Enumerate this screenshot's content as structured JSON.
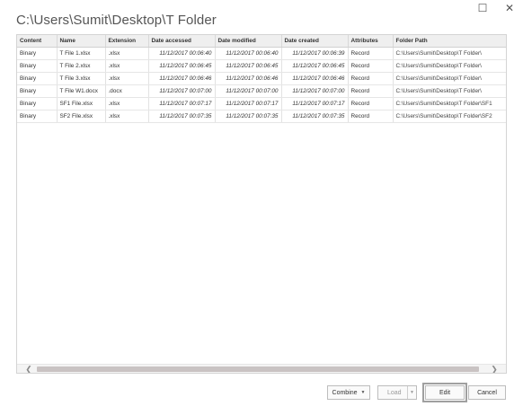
{
  "window": {
    "maximize_glyph": "☐",
    "close_glyph": "✕"
  },
  "title": "C:\\Users\\Sumit\\Desktop\\T Folder",
  "table": {
    "columns": [
      "Content",
      "Name",
      "Extension",
      "Date accessed",
      "Date modified",
      "Date created",
      "Attributes",
      "Folder Path"
    ],
    "rows": [
      [
        "Binary",
        "T File 1.xlsx",
        ".xlsx",
        "11/12/2017 00:06:40",
        "11/12/2017 00:06:40",
        "11/12/2017 00:06:39",
        "Record",
        "C:\\Users\\Sumit\\Desktop\\T Folder\\"
      ],
      [
        "Binary",
        "T File 2.xlsx",
        ".xlsx",
        "11/12/2017 00:06:45",
        "11/12/2017 00:06:45",
        "11/12/2017 00:06:45",
        "Record",
        "C:\\Users\\Sumit\\Desktop\\T Folder\\"
      ],
      [
        "Binary",
        "T File 3.xlsx",
        ".xlsx",
        "11/12/2017 00:06:46",
        "11/12/2017 00:06:46",
        "11/12/2017 00:06:46",
        "Record",
        "C:\\Users\\Sumit\\Desktop\\T Folder\\"
      ],
      [
        "Binary",
        "T File W1.docx",
        ".docx",
        "11/12/2017 00:07:00",
        "11/12/2017 00:07:00",
        "11/12/2017 00:07:00",
        "Record",
        "C:\\Users\\Sumit\\Desktop\\T Folder\\"
      ],
      [
        "Binary",
        "SF1 File.xlsx",
        ".xlsx",
        "11/12/2017 00:07:17",
        "11/12/2017 00:07:17",
        "11/12/2017 00:07:17",
        "Record",
        "C:\\Users\\Sumit\\Desktop\\T Folder\\SF1"
      ],
      [
        "Binary",
        "SF2 File.xlsx",
        ".xlsx",
        "11/12/2017 00:07:35",
        "11/12/2017 00:07:35",
        "11/12/2017 00:07:35",
        "Record",
        "C:\\Users\\Sumit\\Desktop\\T Folder\\SF2"
      ]
    ]
  },
  "scrollbar": {
    "left_arrow": "❮",
    "right_arrow": "❯"
  },
  "buttons": {
    "combine": "Combine",
    "load": "Load",
    "edit": "Edit",
    "cancel": "Cancel",
    "dropdown_caret": "▼"
  }
}
